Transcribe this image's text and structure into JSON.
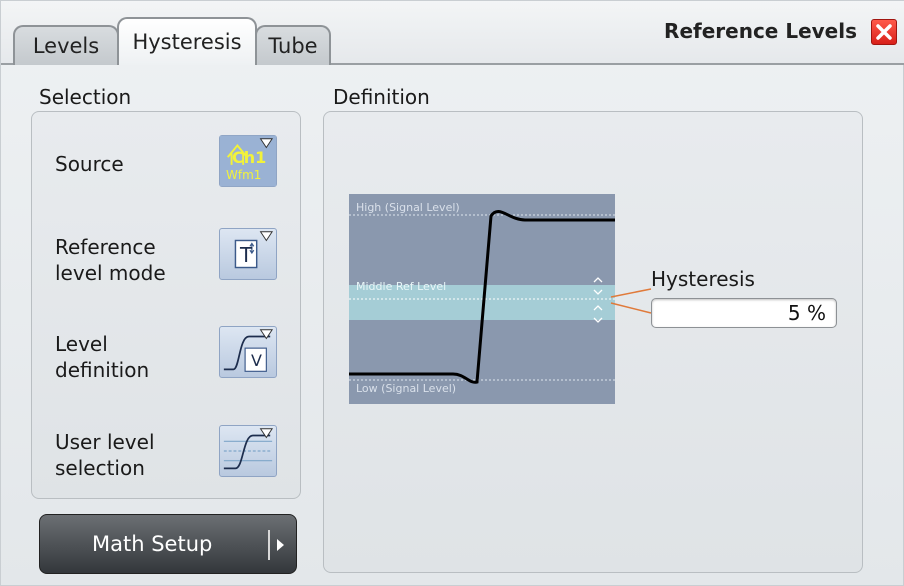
{
  "dialog": {
    "title": "Reference Levels"
  },
  "tabs": [
    {
      "label": "Levels",
      "active": false
    },
    {
      "label": "Hysteresis",
      "active": true
    },
    {
      "label": "Tube",
      "active": false
    }
  ],
  "selection": {
    "heading": "Selection",
    "rows": [
      {
        "label_line1": "Source",
        "label_line2": "",
        "icon": "channel-waveform-icon",
        "icon_text_top": "Ch1",
        "icon_text_bottom": "Wfm1"
      },
      {
        "label_line1": "Reference",
        "label_line2": "level mode",
        "icon": "level-mode-icon",
        "icon_text": "T"
      },
      {
        "label_line1": "Level",
        "label_line2": "definition",
        "icon": "level-definition-icon",
        "icon_text": "V"
      },
      {
        "label_line1": "User level",
        "label_line2": "selection",
        "icon": "user-level-selection-icon"
      }
    ]
  },
  "math_setup": {
    "label": "Math Setup"
  },
  "definition": {
    "heading": "Definition",
    "diagram_labels": {
      "high": "High (Signal Level)",
      "middle": "Middle Ref Level",
      "low": "Low (Signal Level)"
    },
    "hysteresis": {
      "label": "Hysteresis",
      "value": "5 %"
    }
  },
  "colors": {
    "close_button": "#d8201a",
    "diagram_background": "#8a98ae",
    "hysteresis_band": "#a9d6dd",
    "pointer_line": "#e07a3a",
    "icon_yellow": "#f2f23a"
  }
}
